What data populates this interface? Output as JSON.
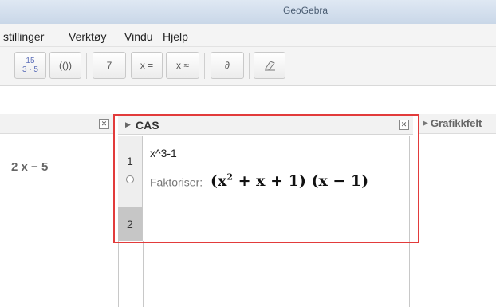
{
  "window": {
    "title": "GeoGebra"
  },
  "menu": [
    "stillinger",
    "Verktøy",
    "Vindu",
    "Hjelp"
  ],
  "toolbar": {
    "fraction_top": "15",
    "fraction_bottom": "3 · 5",
    "parens": "(())",
    "substitute": "7",
    "eval_exact": "x =",
    "eval_approx": "x ≈",
    "derivative": "∂"
  },
  "algebra": {
    "item": "2 x − 5"
  },
  "cas": {
    "title": "CAS",
    "rows": [
      {
        "number": "1",
        "input": "x^3-1",
        "output_label": "Faktoriser:",
        "result_a": "(x",
        "result_exp": "2",
        "result_b": " + x + 1)  (x − 1)"
      },
      {
        "number": "2",
        "input": ""
      }
    ]
  },
  "graphics": {
    "title": "Grafikkfelt"
  }
}
